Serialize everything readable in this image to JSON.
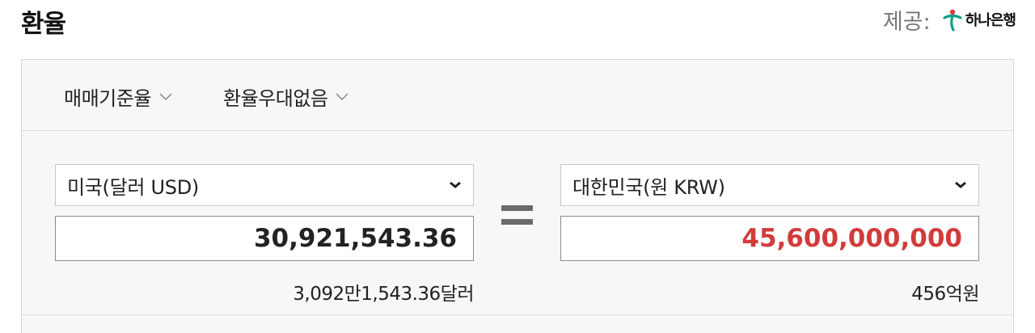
{
  "header": {
    "title": "환율",
    "provider_label": "제공:",
    "provider_name": "하나은행"
  },
  "options": {
    "rate_type": "매매기준율",
    "preferential": "환율우대없음"
  },
  "from": {
    "currency": "미국(달러 USD)",
    "amount": "30,921,543.36",
    "amount_text": "3,092만1,543.36달러"
  },
  "to": {
    "currency": "대한민국(원 KRW)",
    "amount": "45,600,000,000",
    "amount_text": "456억원"
  },
  "icons": {
    "dropdown": "chevron-down-icon",
    "select": "caret-down-icon",
    "equals": "equals-icon",
    "logo": "hana-bank-logo"
  },
  "colors": {
    "accent_red": "#d23b3b",
    "bank_green": "#0a9e87",
    "bank_red": "#e0393e"
  }
}
